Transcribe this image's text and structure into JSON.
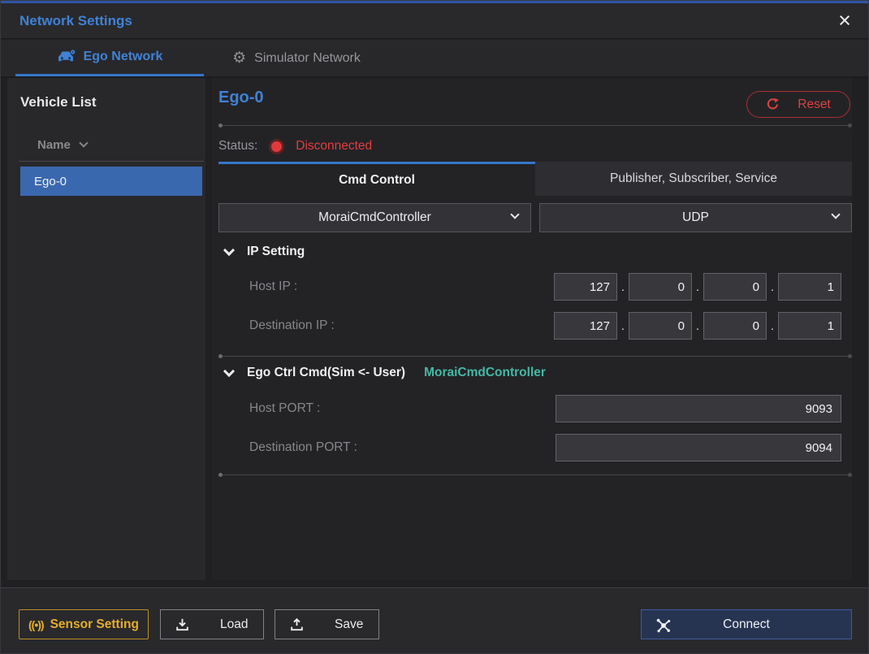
{
  "window": {
    "title": "Network Settings"
  },
  "icons": {
    "close": "×",
    "gear": "⚙",
    "sensor": "((•))"
  },
  "tabs": {
    "ego": {
      "label": "Ego Network"
    },
    "simulator": {
      "label": "Simulator Network"
    }
  },
  "sidebar": {
    "title": "Vehicle List",
    "column_header": "Name",
    "rows": [
      {
        "name": "Ego-0",
        "selected": true
      }
    ]
  },
  "main": {
    "vehicle_title": "Ego-0",
    "reset_label": "Reset",
    "status_label": "Status:",
    "status_value": "Disconnected",
    "subtabs": {
      "cmd_control": "Cmd Control",
      "pub_sub": "Publisher, Subscriber, Service"
    },
    "dropdowns": {
      "controller": "MoraiCmdController",
      "protocol": "UDP"
    },
    "ip_setting": {
      "title": "IP Setting",
      "host_ip_label": "Host IP :",
      "host_ip": [
        "127",
        "0",
        "0",
        "1"
      ],
      "dest_ip_label": "Destination IP :",
      "dest_ip": [
        "127",
        "0",
        "0",
        "1"
      ]
    },
    "ego_ctrl": {
      "title": "Ego Ctrl Cmd(Sim <- User)",
      "subtitle": "MoraiCmdController",
      "host_port_label": "Host PORT :",
      "host_port": "9093",
      "dest_port_label": "Destination PORT :",
      "dest_port": "9094"
    }
  },
  "footer": {
    "sensor_setting_label": "Sensor Setting",
    "load_label": "Load",
    "save_label": "Save",
    "connect_label": "Connect"
  },
  "colors": {
    "accent_blue": "#3f82d6",
    "tab_underline": "#3576c9",
    "selected_row": "#3a68ae",
    "status_red": "#e23e3e",
    "teal": "#44b9a6",
    "amber": "#e6ad2d",
    "connect_bg": "#263452",
    "connect_border": "#3b5c9e",
    "panel_bg": "#232326"
  }
}
